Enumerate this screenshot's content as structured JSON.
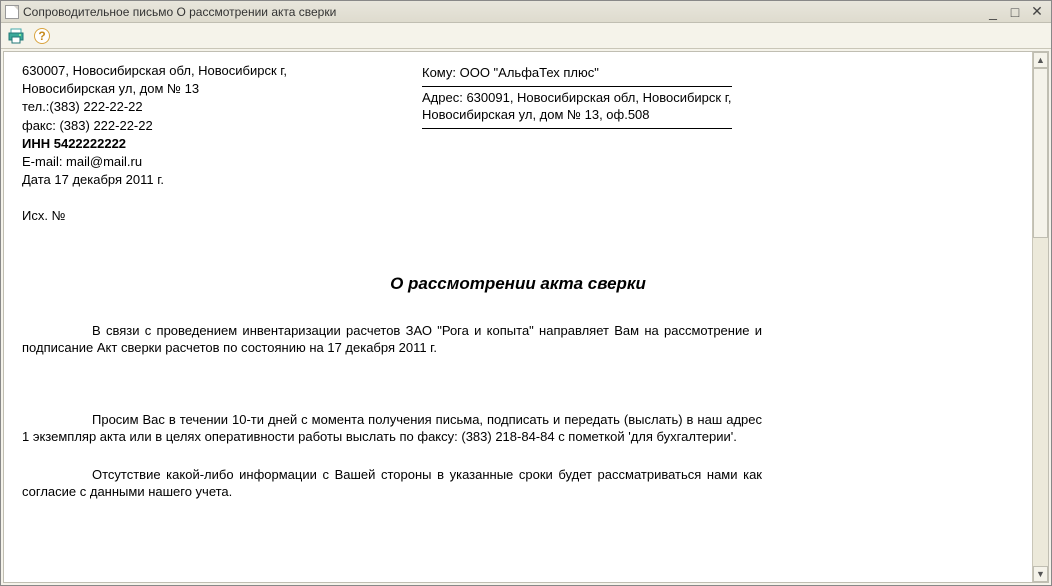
{
  "window": {
    "title": "Сопроводительное письмо О рассмотрении акта сверки"
  },
  "sender": {
    "address_l1": "630007, Новосибирская обл, Новосибирск г,",
    "address_l2": "Новосибирская ул, дом № 13",
    "tel": "тел.:(383) 222-22-22",
    "fax": "факс: (383) 222-22-22",
    "inn": "ИНН 5422222222",
    "email": "E-mail: mail@mail.ru",
    "date": "Дата  17 декабря 2011 г.",
    "outgoing": "Исх. №"
  },
  "recipient": {
    "to": "Кому: ООО \"АльфаТех плюс\"",
    "addr": "Адрес: 630091, Новосибирская обл, Новосибирск г, Новосибирская ул, дом № 13, оф.508"
  },
  "title": "О рассмотрении акта сверки",
  "para1": "В связи с проведением инвентаризации расчетов ЗАО \"Рога и копыта\" направляет Вам на рассмотрение и подписание Акт сверки расчетов  по состоянию на 17 декабря 2011 г.",
  "para2": "Просим Вас в течении 10-ти дней с момента получения письма, подписать и передать (выслать) в наш адрес 1 экземпляр акта или в целях оперативности работы выслать по факсу: (383) 218-84-84 с пометкой 'для бухгалтерии'.",
  "para3": "Отсутствие какой-либо информации с Вашей стороны в указанные сроки будет рассматриваться нами как согласие с данными нашего учета."
}
